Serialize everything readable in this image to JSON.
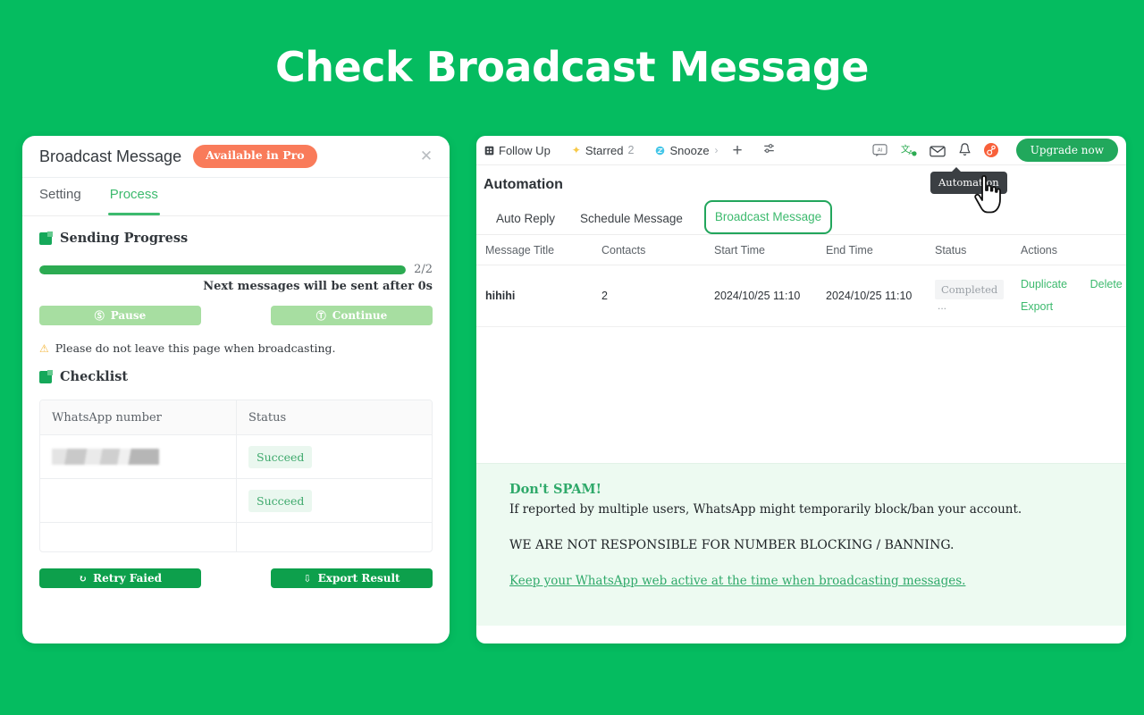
{
  "page": {
    "title": "Check Broadcast Message",
    "background_color": "#05BC60"
  },
  "dialog": {
    "title": "Broadcast Message",
    "badge": "Available in Pro",
    "close_icon": "close-icon",
    "tabs": [
      {
        "label": "Setting",
        "active": false
      },
      {
        "label": "Process",
        "active": true
      }
    ],
    "sending_progress": {
      "section_title": "Sending Progress",
      "value": 100,
      "counter": "2/2",
      "note": "Next messages will be sent after 0s"
    },
    "controls": {
      "pause_label": "Pause",
      "pause_icon": "pause-circle-icon",
      "continue_label": "Continue",
      "continue_icon": "play-circle-icon"
    },
    "warning": {
      "icon": "warning-triangle-icon",
      "text": "Please do not leave this page when broadcasting."
    },
    "checklist": {
      "section_title": "Checklist",
      "columns": [
        "WhatsApp number",
        "Status"
      ],
      "rows": [
        {
          "number": "",
          "redacted": true,
          "status": "Succeed"
        },
        {
          "number": "",
          "redacted": false,
          "status": "Succeed"
        }
      ]
    },
    "footer": {
      "retry_label": "Retry Faied",
      "retry_icon": "refresh-icon",
      "export_label": "Export Result",
      "export_icon": "download-icon"
    },
    "colors": {
      "accent_green": "#3DBA6E",
      "solid_green": "#0DA04C",
      "disabled_green": "#A7DEA1",
      "badge_coral": "#F97B5A"
    }
  },
  "app": {
    "toolbar": {
      "items": [
        {
          "label": "Follow Up",
          "icon": "follow-up-icon",
          "count": ""
        },
        {
          "label": "Starred",
          "icon": "sparkle-icon",
          "count": "2"
        },
        {
          "label": "Snooze",
          "icon": "snooze-clock-icon",
          "count": ""
        }
      ],
      "chevron_icon": "chevron-right-icon",
      "add_icon": "plus-icon",
      "filter_icon": "sliders-icon",
      "right_icons": [
        "ai-chat-icon",
        "translate-icon",
        "envelope-icon",
        "bell-icon",
        "hubspot-icon"
      ],
      "upgrade_label": "Upgrade now"
    },
    "tooltip": {
      "text": "Automation",
      "cursor_icon": "pointing-hand-cursor"
    },
    "page_title": "Automation",
    "tabs": [
      {
        "label": "Auto Reply",
        "selected": false
      },
      {
        "label": "Schedule Message",
        "selected": false
      },
      {
        "label": "Broadcast Message",
        "selected": true
      }
    ],
    "table": {
      "columns": [
        "Message Title",
        "Contacts",
        "Start Time",
        "End Time",
        "Status",
        "Actions"
      ],
      "rows": [
        {
          "message_title": "hihihi",
          "contacts": "2",
          "start_time": "2024/10/25 11:10",
          "end_time": "2024/10/25 11:10",
          "status": "Completed",
          "status_more": "...",
          "actions": [
            "Duplicate",
            "Delete",
            "Export"
          ]
        }
      ]
    },
    "spam_notice": {
      "title": "Don't SPAM!",
      "line1": "If reported by multiple users, WhatsApp might temporarily block/ban your account.",
      "line2": "WE ARE NOT RESPONSIBLE FOR NUMBER BLOCKING / BANNING.",
      "link": "Keep your WhatsApp web active at the time when broadcasting messages."
    }
  }
}
